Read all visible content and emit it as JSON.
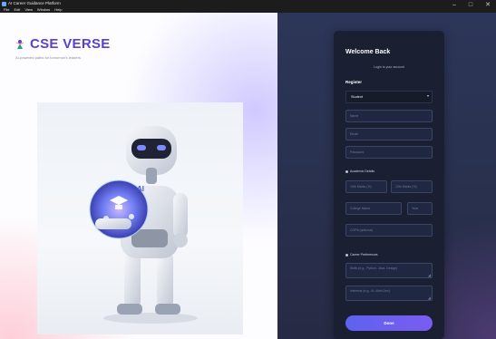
{
  "window": {
    "title": "AI Career Guidance Platform",
    "menu": [
      "File",
      "Edit",
      "View",
      "Window",
      "Help"
    ],
    "controls": {
      "minimize": "–",
      "maximize": "□",
      "close": "✕"
    }
  },
  "brand": {
    "name": "CSE VERSE",
    "tagline": "AI-powered paths for tomorrow's leaders",
    "accent": "#5b3fd1"
  },
  "hero": {
    "globe_label": "AI"
  },
  "form": {
    "heading": "Welcome Back",
    "subheading": "Login to your account",
    "tab": "Register",
    "role": {
      "value": "Student"
    },
    "fields": {
      "name": "Name",
      "email": "Email",
      "password": "Password",
      "tenth_marks": "10th Marks (%)",
      "twelfth_marks": "12th Marks (%)",
      "college": "College Name",
      "year": "Year",
      "cgpa": "CGPA (optional)",
      "skills": "Skills (e.g., Python, Java, Design)",
      "interests": "Interests (e.g., AI, Web Dev)"
    },
    "sections": {
      "academic": "Academic Details",
      "career": "Career Preferences"
    },
    "submit": "Done",
    "button_color": "#5e62f0"
  }
}
